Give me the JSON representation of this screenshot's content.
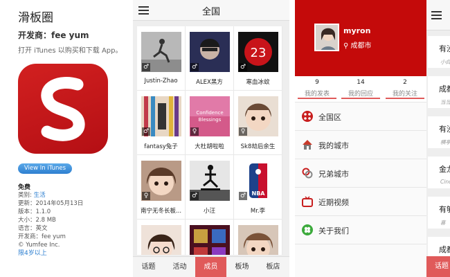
{
  "store": {
    "app_name": "滑板圈",
    "developer": "开发商：fee yum",
    "itunes_note": "打开 iTunes 以购买和下载 App。",
    "itunes_button": "View In iTunes",
    "price": "免费",
    "category_label": "类别: ",
    "category_value": "生活",
    "updated": "更新：2014年05月13日",
    "version": "版本：1.1.0",
    "size": "大小：2.8 MB",
    "language": "语言：英文",
    "developer_meta": "开发商：fee yum",
    "copyright": "© Yumfee Inc.",
    "age_rating": "限4岁以上",
    "accent_color": "#c40a0a"
  },
  "members": {
    "title": "全国",
    "users": [
      {
        "name": "Justin-Zhao",
        "gender": "♂"
      },
      {
        "name": "ALEX黑方",
        "gender": "♂"
      },
      {
        "name": "寒血冰蚊",
        "gender": "♂"
      },
      {
        "name": "fantasy兔子",
        "gender": "♂"
      },
      {
        "name": "大杜胡啦啦",
        "gender": "♀"
      },
      {
        "name": "Sk8劫后余生",
        "gender": "♀"
      },
      {
        "name": "南宁无冬长板...",
        "gender": "♀"
      },
      {
        "name": "小汪",
        "gender": "♂"
      },
      {
        "name": "Mr.李",
        "gender": "♂"
      },
      {
        "name": "",
        "gender": ""
      },
      {
        "name": "",
        "gender": ""
      },
      {
        "name": "",
        "gender": ""
      }
    ],
    "tabs": [
      "话题",
      "活动",
      "成员",
      "板场",
      "板店"
    ],
    "active_tab": 2
  },
  "profile": {
    "name": "myron",
    "city": "成都市",
    "stats": [
      {
        "num": "9",
        "label": "我的发表"
      },
      {
        "num": "14",
        "label": "我的回应"
      },
      {
        "num": "2",
        "label": "我的关注"
      }
    ],
    "menu": [
      {
        "label": "全国区",
        "icon": "globe-dots-icon"
      },
      {
        "label": "我的城市",
        "icon": "house-icon"
      },
      {
        "label": "兄弟城市",
        "icon": "linked-circles-icon"
      },
      {
        "label": "近期视频",
        "icon": "tv-icon"
      },
      {
        "label": "关于我们",
        "icon": "clover-icon"
      }
    ]
  },
  "topics": {
    "rows": [
      {
        "title": "有没",
        "sub": "小白"
      },
      {
        "title": "成都",
        "sub": "当当"
      },
      {
        "title": "有没",
        "sub": "横亭"
      },
      {
        "title": "金龙",
        "sub": "Cinc"
      },
      {
        "title": "有够",
        "sub": "喜"
      },
      {
        "title": "成都",
        "sub": ""
      }
    ],
    "active_tab": "话题"
  }
}
